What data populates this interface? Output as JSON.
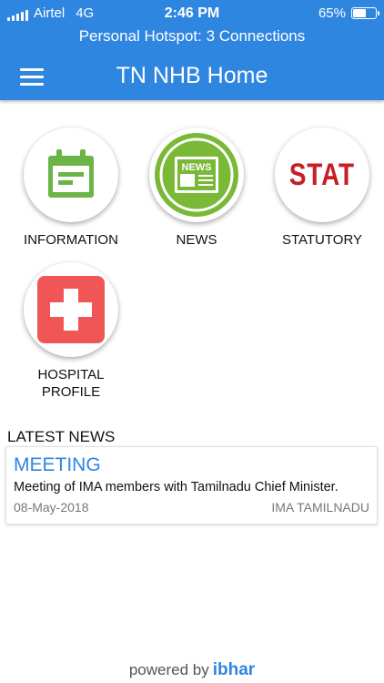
{
  "status_bar": {
    "carrier": "Airtel",
    "network": "4G",
    "time": "2:46 PM",
    "battery": "65%",
    "battery_level": 0.65,
    "hotspot": "Personal Hotspot: 3 Connections"
  },
  "app_bar": {
    "title": "TN NHB Home",
    "menu_icon": "hamburger-menu-icon"
  },
  "tiles": [
    {
      "label": "INFORMATION",
      "icon": "calendar-icon",
      "color": "#6ab545"
    },
    {
      "label": "NEWS",
      "icon": "newspaper-icon",
      "color": "#79b936",
      "icon_text": "NEWS"
    },
    {
      "label": "STATUTORY",
      "icon": "stat-text-icon",
      "color": "#c62026",
      "icon_text": "STAT"
    },
    {
      "label": "HOSPITAL\nPROFILE",
      "icon": "medical-cross-icon",
      "color": "#f05656"
    }
  ],
  "latest_news": {
    "title": "LATEST NEWS",
    "items": [
      {
        "heading": "MEETING",
        "description": "Meeting of IMA members with Tamilnadu Chief Minister.",
        "date": "08-May-2018",
        "source": "IMA TAMILNADU"
      }
    ]
  },
  "footer": {
    "powered_by": "powered by",
    "brand": "ibhar"
  },
  "colors": {
    "primary": "#2f86e0"
  }
}
